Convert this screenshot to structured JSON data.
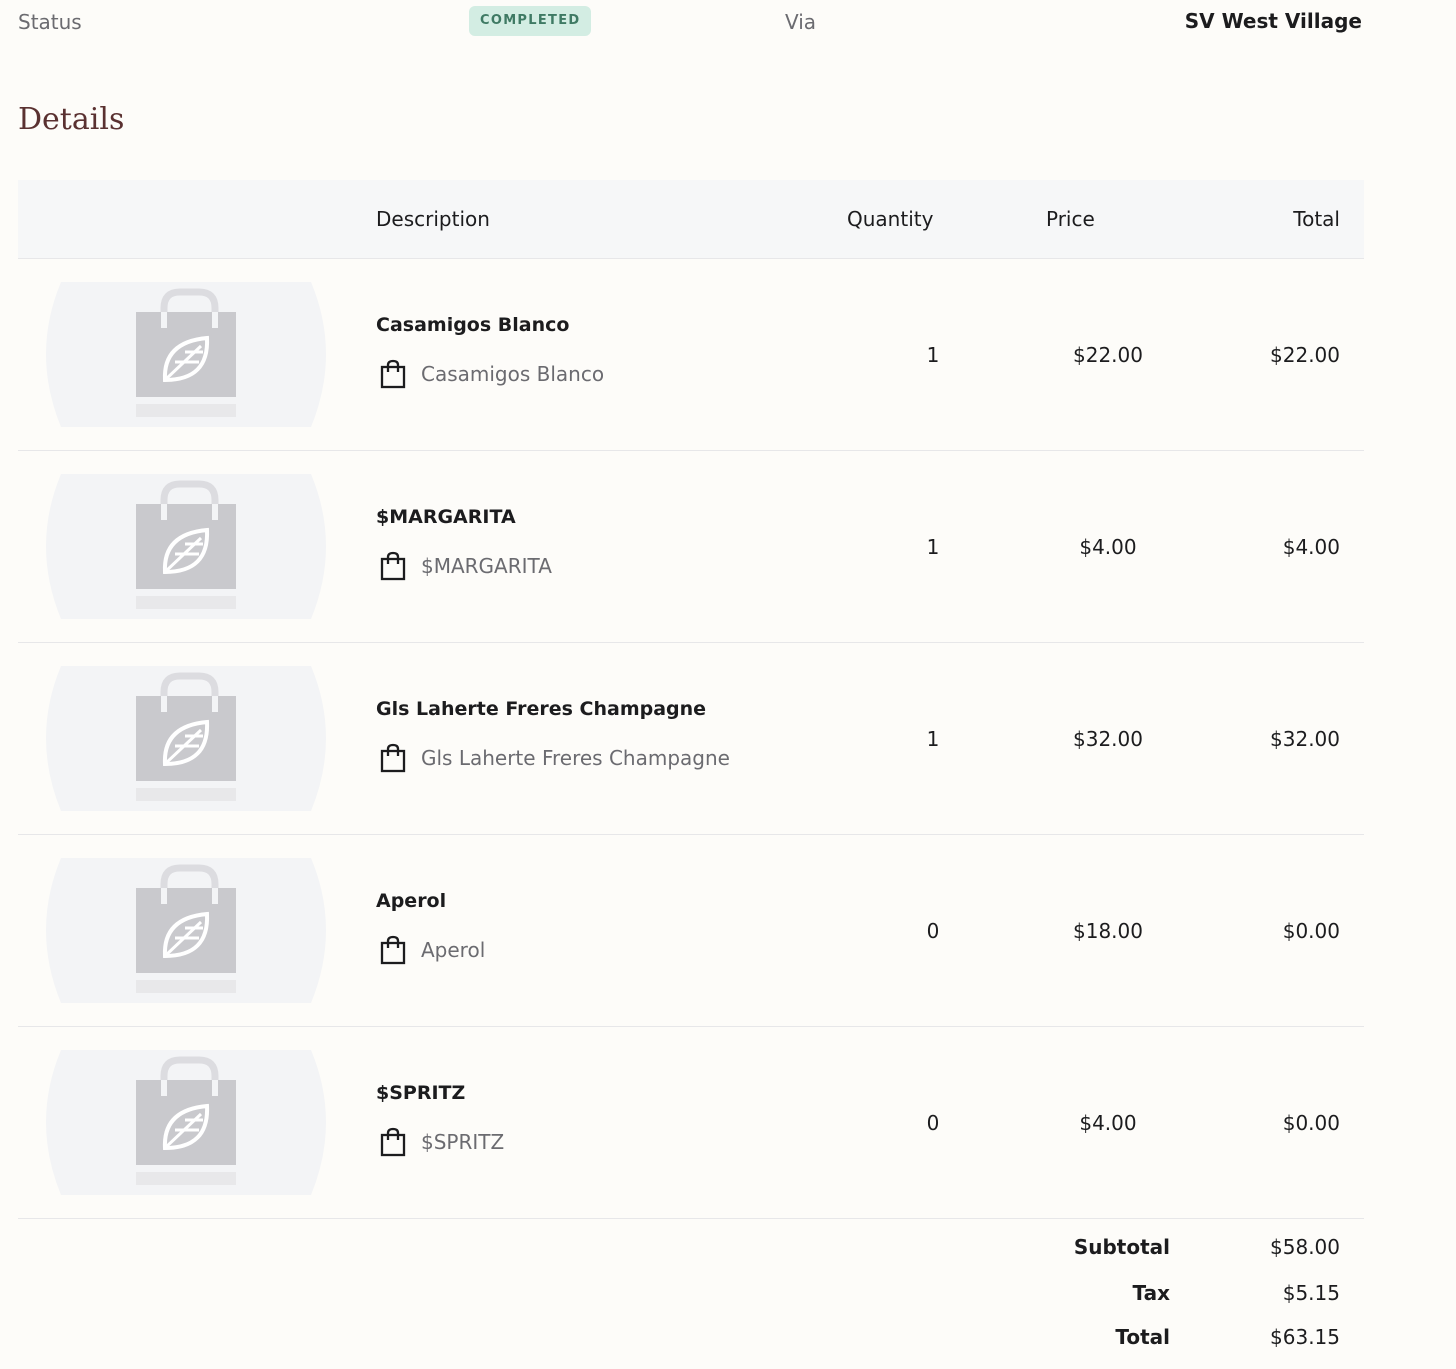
{
  "status": {
    "label": "Status",
    "badge": "COMPLETED",
    "via_label": "Via",
    "location": "SV West Village"
  },
  "details": {
    "title": "Details",
    "columns": {
      "description": "Description",
      "quantity": "Quantity",
      "price": "Price",
      "total": "Total"
    },
    "items": [
      {
        "name": "Casamigos Blanco",
        "sub": "Casamigos Blanco",
        "quantity": "1",
        "price": "$22.00",
        "total": "$22.00"
      },
      {
        "name": "$MARGARITA",
        "sub": "$MARGARITA",
        "quantity": "1",
        "price": "$4.00",
        "total": "$4.00"
      },
      {
        "name": "Gls Laherte Freres Champagne",
        "sub": "Gls Laherte Freres Champagne",
        "quantity": "1",
        "price": "$32.00",
        "total": "$32.00"
      },
      {
        "name": "Aperol",
        "sub": "Aperol",
        "quantity": "0",
        "price": "$18.00",
        "total": "$0.00"
      },
      {
        "name": "$SPRITZ",
        "sub": "$SPRITZ",
        "quantity": "0",
        "price": "$4.00",
        "total": "$0.00"
      }
    ],
    "summary": {
      "subtotal_label": "Subtotal",
      "subtotal": "$58.00",
      "tax_label": "Tax",
      "tax": "$5.15",
      "total_label": "Total",
      "total": "$63.15"
    }
  },
  "icons": {
    "product_placeholder": "product-placeholder-icon",
    "bag": "shopping-bag-icon"
  },
  "colors": {
    "background": "#fdfcf9",
    "badge_bg": "#d3ede3",
    "badge_text": "#3f7a64",
    "title": "#5a3131",
    "muted": "#6b6b70",
    "header_bg": "#f6f7f8"
  }
}
